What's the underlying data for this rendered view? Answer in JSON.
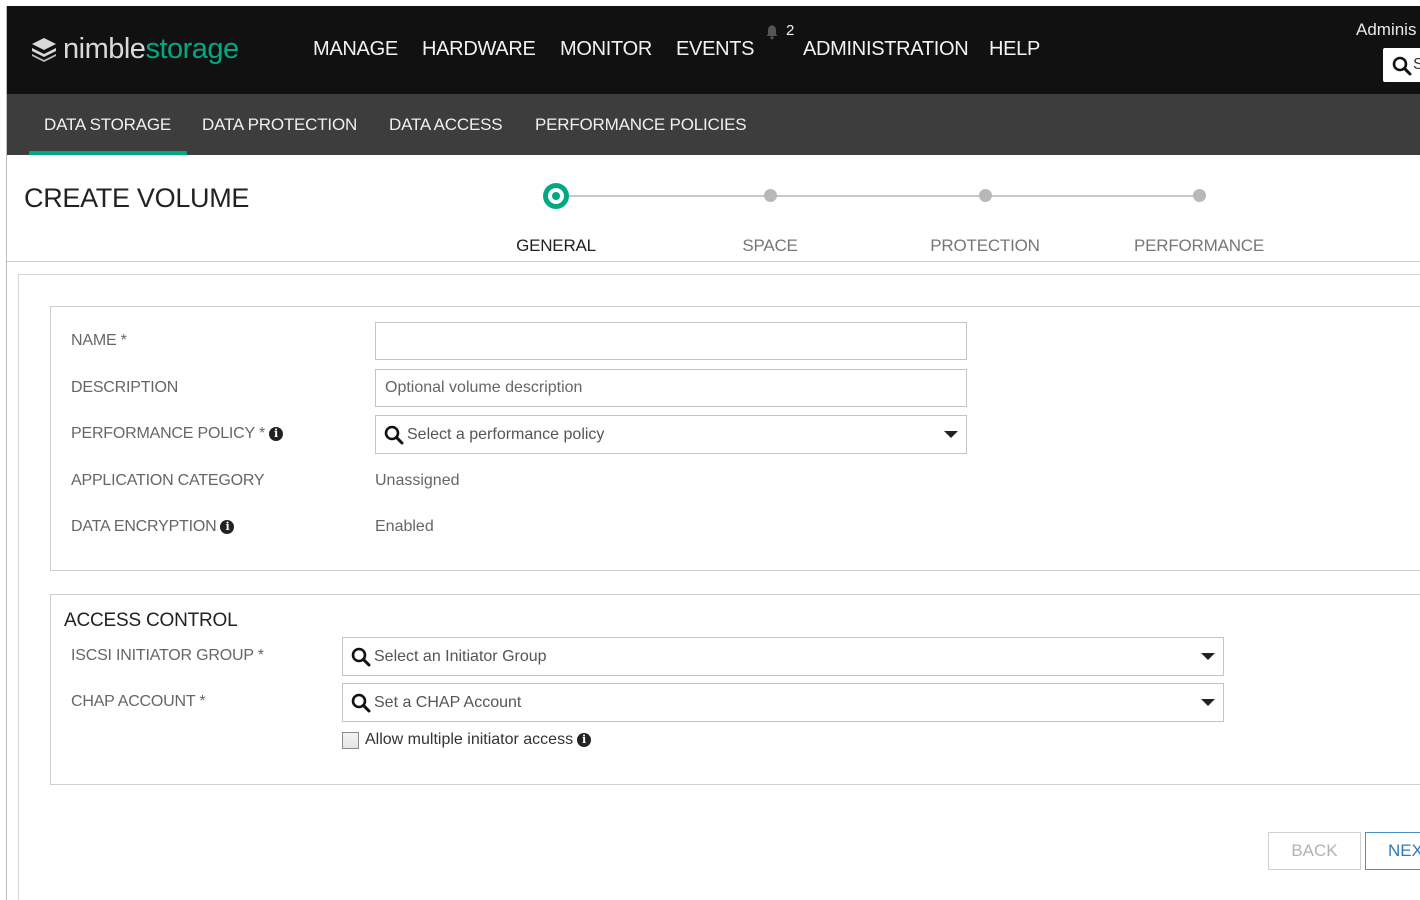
{
  "brand": {
    "part1": "nimble",
    "part2": "storage"
  },
  "topnav": {
    "items": [
      "MANAGE",
      "HARDWARE",
      "MONITOR",
      "EVENTS",
      "ADMINISTRATION",
      "HELP"
    ],
    "notification_count": "2",
    "user": "Adminis",
    "search_partial": "S"
  },
  "subnav": {
    "items": [
      "DATA STORAGE",
      "DATA PROTECTION",
      "DATA ACCESS",
      "PERFORMANCE POLICIES"
    ],
    "active": "DATA STORAGE"
  },
  "page": {
    "title": "CREATE VOLUME"
  },
  "wizard": {
    "steps": [
      "GENERAL",
      "SPACE",
      "PROTECTION",
      "PERFORMANCE"
    ],
    "current": "GENERAL"
  },
  "general": {
    "name_label": "NAME *",
    "name_value": "",
    "description_label": "DESCRIPTION",
    "description_placeholder": "Optional volume description",
    "perf_policy_label": "PERFORMANCE POLICY *",
    "perf_policy_placeholder": "Select a performance policy",
    "app_category_label": "APPLICATION CATEGORY",
    "app_category_value": "Unassigned",
    "encryption_label": "DATA ENCRYPTION",
    "encryption_value": "Enabled"
  },
  "access": {
    "title": "ACCESS CONTROL",
    "iscsi_label": "ISCSI INITIATOR GROUP *",
    "iscsi_placeholder": "Select an Initiator Group",
    "chap_label": "CHAP ACCOUNT *",
    "chap_placeholder": "Set a CHAP Account",
    "multi_access_label": "Allow multiple initiator access",
    "multi_access_checked": false
  },
  "buttons": {
    "back": "BACK",
    "next": "NEX"
  },
  "colors": {
    "brand_green": "#01a982",
    "topbar": "#111111",
    "subbar": "#3d3d3d",
    "link_blue": "#2f79b8"
  },
  "icons": [
    "nimble-logo-icon",
    "bell-icon",
    "search-icon",
    "info-icon",
    "chevron-down-icon",
    "checkbox-icon"
  ]
}
